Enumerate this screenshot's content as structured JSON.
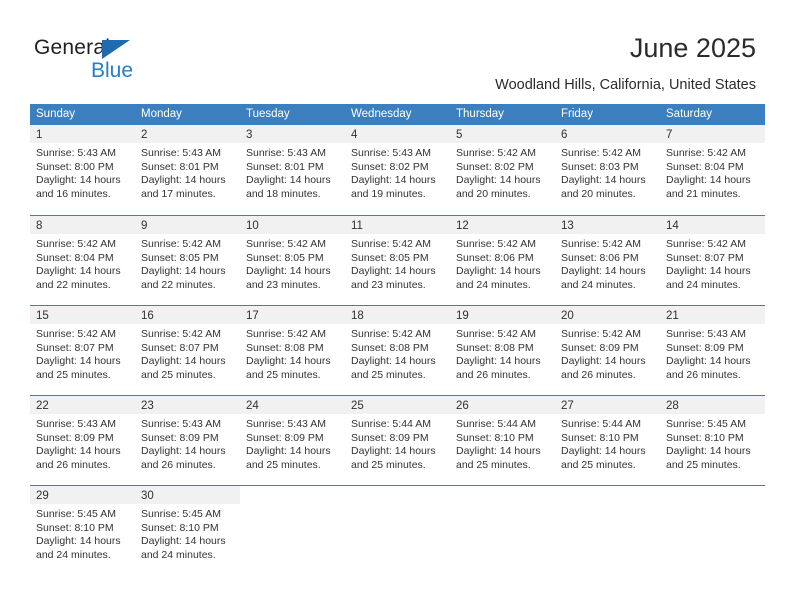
{
  "brand": {
    "name_part1": "General",
    "name_part2": "Blue",
    "triangle_color": "#1f6bb0",
    "blue_color": "#1f7fd0"
  },
  "header": {
    "title": "June 2025",
    "subtitle": "Woodland Hills, California, United States"
  },
  "theme": {
    "header_blue": "#3c7fbf",
    "daynum_bg": "#f1f1f1",
    "text": "#333333"
  },
  "calendar": {
    "day_names": [
      "Sunday",
      "Monday",
      "Tuesday",
      "Wednesday",
      "Thursday",
      "Friday",
      "Saturday"
    ],
    "weeks": [
      [
        {
          "day": "1",
          "sunrise": "Sunrise: 5:43 AM",
          "sunset": "Sunset: 8:00 PM",
          "daylight1": "Daylight: 14 hours",
          "daylight2": "and 16 minutes."
        },
        {
          "day": "2",
          "sunrise": "Sunrise: 5:43 AM",
          "sunset": "Sunset: 8:01 PM",
          "daylight1": "Daylight: 14 hours",
          "daylight2": "and 17 minutes."
        },
        {
          "day": "3",
          "sunrise": "Sunrise: 5:43 AM",
          "sunset": "Sunset: 8:01 PM",
          "daylight1": "Daylight: 14 hours",
          "daylight2": "and 18 minutes."
        },
        {
          "day": "4",
          "sunrise": "Sunrise: 5:43 AM",
          "sunset": "Sunset: 8:02 PM",
          "daylight1": "Daylight: 14 hours",
          "daylight2": "and 19 minutes."
        },
        {
          "day": "5",
          "sunrise": "Sunrise: 5:42 AM",
          "sunset": "Sunset: 8:02 PM",
          "daylight1": "Daylight: 14 hours",
          "daylight2": "and 20 minutes."
        },
        {
          "day": "6",
          "sunrise": "Sunrise: 5:42 AM",
          "sunset": "Sunset: 8:03 PM",
          "daylight1": "Daylight: 14 hours",
          "daylight2": "and 20 minutes."
        },
        {
          "day": "7",
          "sunrise": "Sunrise: 5:42 AM",
          "sunset": "Sunset: 8:04 PM",
          "daylight1": "Daylight: 14 hours",
          "daylight2": "and 21 minutes."
        }
      ],
      [
        {
          "day": "8",
          "sunrise": "Sunrise: 5:42 AM",
          "sunset": "Sunset: 8:04 PM",
          "daylight1": "Daylight: 14 hours",
          "daylight2": "and 22 minutes."
        },
        {
          "day": "9",
          "sunrise": "Sunrise: 5:42 AM",
          "sunset": "Sunset: 8:05 PM",
          "daylight1": "Daylight: 14 hours",
          "daylight2": "and 22 minutes."
        },
        {
          "day": "10",
          "sunrise": "Sunrise: 5:42 AM",
          "sunset": "Sunset: 8:05 PM",
          "daylight1": "Daylight: 14 hours",
          "daylight2": "and 23 minutes."
        },
        {
          "day": "11",
          "sunrise": "Sunrise: 5:42 AM",
          "sunset": "Sunset: 8:05 PM",
          "daylight1": "Daylight: 14 hours",
          "daylight2": "and 23 minutes."
        },
        {
          "day": "12",
          "sunrise": "Sunrise: 5:42 AM",
          "sunset": "Sunset: 8:06 PM",
          "daylight1": "Daylight: 14 hours",
          "daylight2": "and 24 minutes."
        },
        {
          "day": "13",
          "sunrise": "Sunrise: 5:42 AM",
          "sunset": "Sunset: 8:06 PM",
          "daylight1": "Daylight: 14 hours",
          "daylight2": "and 24 minutes."
        },
        {
          "day": "14",
          "sunrise": "Sunrise: 5:42 AM",
          "sunset": "Sunset: 8:07 PM",
          "daylight1": "Daylight: 14 hours",
          "daylight2": "and 24 minutes."
        }
      ],
      [
        {
          "day": "15",
          "sunrise": "Sunrise: 5:42 AM",
          "sunset": "Sunset: 8:07 PM",
          "daylight1": "Daylight: 14 hours",
          "daylight2": "and 25 minutes."
        },
        {
          "day": "16",
          "sunrise": "Sunrise: 5:42 AM",
          "sunset": "Sunset: 8:07 PM",
          "daylight1": "Daylight: 14 hours",
          "daylight2": "and 25 minutes."
        },
        {
          "day": "17",
          "sunrise": "Sunrise: 5:42 AM",
          "sunset": "Sunset: 8:08 PM",
          "daylight1": "Daylight: 14 hours",
          "daylight2": "and 25 minutes."
        },
        {
          "day": "18",
          "sunrise": "Sunrise: 5:42 AM",
          "sunset": "Sunset: 8:08 PM",
          "daylight1": "Daylight: 14 hours",
          "daylight2": "and 25 minutes."
        },
        {
          "day": "19",
          "sunrise": "Sunrise: 5:42 AM",
          "sunset": "Sunset: 8:08 PM",
          "daylight1": "Daylight: 14 hours",
          "daylight2": "and 26 minutes."
        },
        {
          "day": "20",
          "sunrise": "Sunrise: 5:42 AM",
          "sunset": "Sunset: 8:09 PM",
          "daylight1": "Daylight: 14 hours",
          "daylight2": "and 26 minutes."
        },
        {
          "day": "21",
          "sunrise": "Sunrise: 5:43 AM",
          "sunset": "Sunset: 8:09 PM",
          "daylight1": "Daylight: 14 hours",
          "daylight2": "and 26 minutes."
        }
      ],
      [
        {
          "day": "22",
          "sunrise": "Sunrise: 5:43 AM",
          "sunset": "Sunset: 8:09 PM",
          "daylight1": "Daylight: 14 hours",
          "daylight2": "and 26 minutes."
        },
        {
          "day": "23",
          "sunrise": "Sunrise: 5:43 AM",
          "sunset": "Sunset: 8:09 PM",
          "daylight1": "Daylight: 14 hours",
          "daylight2": "and 26 minutes."
        },
        {
          "day": "24",
          "sunrise": "Sunrise: 5:43 AM",
          "sunset": "Sunset: 8:09 PM",
          "daylight1": "Daylight: 14 hours",
          "daylight2": "and 25 minutes."
        },
        {
          "day": "25",
          "sunrise": "Sunrise: 5:44 AM",
          "sunset": "Sunset: 8:09 PM",
          "daylight1": "Daylight: 14 hours",
          "daylight2": "and 25 minutes."
        },
        {
          "day": "26",
          "sunrise": "Sunrise: 5:44 AM",
          "sunset": "Sunset: 8:10 PM",
          "daylight1": "Daylight: 14 hours",
          "daylight2": "and 25 minutes."
        },
        {
          "day": "27",
          "sunrise": "Sunrise: 5:44 AM",
          "sunset": "Sunset: 8:10 PM",
          "daylight1": "Daylight: 14 hours",
          "daylight2": "and 25 minutes."
        },
        {
          "day": "28",
          "sunrise": "Sunrise: 5:45 AM",
          "sunset": "Sunset: 8:10 PM",
          "daylight1": "Daylight: 14 hours",
          "daylight2": "and 25 minutes."
        }
      ],
      [
        {
          "day": "29",
          "sunrise": "Sunrise: 5:45 AM",
          "sunset": "Sunset: 8:10 PM",
          "daylight1": "Daylight: 14 hours",
          "daylight2": "and 24 minutes."
        },
        {
          "day": "30",
          "sunrise": "Sunrise: 5:45 AM",
          "sunset": "Sunset: 8:10 PM",
          "daylight1": "Daylight: 14 hours",
          "daylight2": "and 24 minutes."
        },
        {
          "day": "",
          "sunrise": "",
          "sunset": "",
          "daylight1": "",
          "daylight2": ""
        },
        {
          "day": "",
          "sunrise": "",
          "sunset": "",
          "daylight1": "",
          "daylight2": ""
        },
        {
          "day": "",
          "sunrise": "",
          "sunset": "",
          "daylight1": "",
          "daylight2": ""
        },
        {
          "day": "",
          "sunrise": "",
          "sunset": "",
          "daylight1": "",
          "daylight2": ""
        },
        {
          "day": "",
          "sunrise": "",
          "sunset": "",
          "daylight1": "",
          "daylight2": ""
        }
      ]
    ]
  }
}
